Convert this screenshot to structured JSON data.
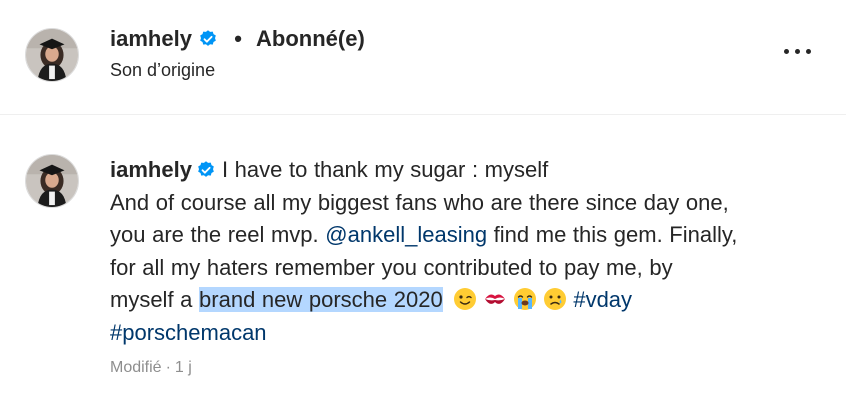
{
  "header": {
    "username": "iamhely",
    "separator": "•",
    "follow_status": "Abonné(e)",
    "audio": "Son d’origine"
  },
  "caption": {
    "username": "iamhely",
    "line1": "I have to thank my sugar : myself",
    "line2": "And of course all my biggest fans who are there since day one,",
    "line3_prefix": "you are the reel mvp. ",
    "mention": "@ankell_leasing",
    "line3_suffix": " find me this gem. Finally,",
    "line4": "for all my haters remember you contributed to pay me, by",
    "line5_prefix": "myself a ",
    "highlighted": "brand new porsche 2020",
    "hashtag1": "#vday",
    "hashtag2": "#porschemacan",
    "emojis": [
      "winking-face",
      "kiss-mark",
      "loudly-crying-face",
      "crying-face"
    ]
  },
  "meta": {
    "edited": "Modifié",
    "separator": "·",
    "age": "1 j"
  },
  "colors": {
    "text": "#262626",
    "link": "#00376b",
    "verified": "#0095f6",
    "selection": "#b4d7ff",
    "muted": "#8e8e8e",
    "divider": "#efefef"
  }
}
